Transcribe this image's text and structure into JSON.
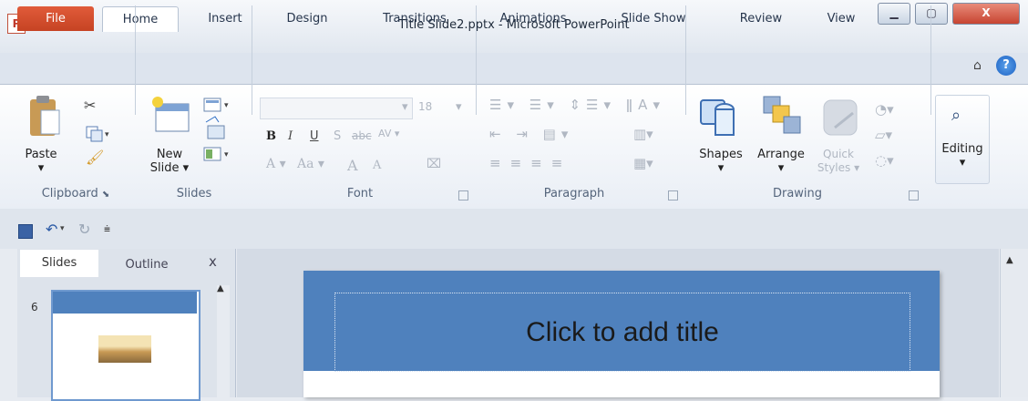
{
  "window": {
    "title": "Title Slide2.pptx - Microsoft PowerPoint",
    "app_icon": "P",
    "close_glyph": "X"
  },
  "tabs": [
    "File",
    "Home",
    "Insert",
    "Design",
    "Transitions",
    "Animations",
    "Slide Show",
    "Review",
    "View"
  ],
  "ribbon": {
    "clipboard": {
      "label": "Clipboard",
      "paste": "Paste"
    },
    "slides": {
      "label": "Slides",
      "new_slide_1": "New",
      "new_slide_2": "Slide"
    },
    "font": {
      "label": "Font",
      "size": "18",
      "bold": "B",
      "italic": "I",
      "underline": "U",
      "shadow": "S",
      "strike": "abc",
      "spacing": "AV",
      "color": "A",
      "case": "Aa",
      "grow": "A",
      "shrink": "A"
    },
    "paragraph": {
      "label": "Paragraph"
    },
    "drawing": {
      "label": "Drawing",
      "shapes": "Shapes",
      "arrange": "Arrange",
      "quick_styles_1": "Quick",
      "quick_styles_2": "Styles"
    },
    "editing": {
      "label": "Editing"
    }
  },
  "panel": {
    "tab_slides": "Slides",
    "tab_outline": "Outline",
    "close": "x",
    "slide_number": "6"
  },
  "slide": {
    "title_placeholder": "Click to add title"
  },
  "colors": {
    "file_tab": "#d24726",
    "slide_band": "#4f81bd",
    "help": "#1d62c4"
  }
}
